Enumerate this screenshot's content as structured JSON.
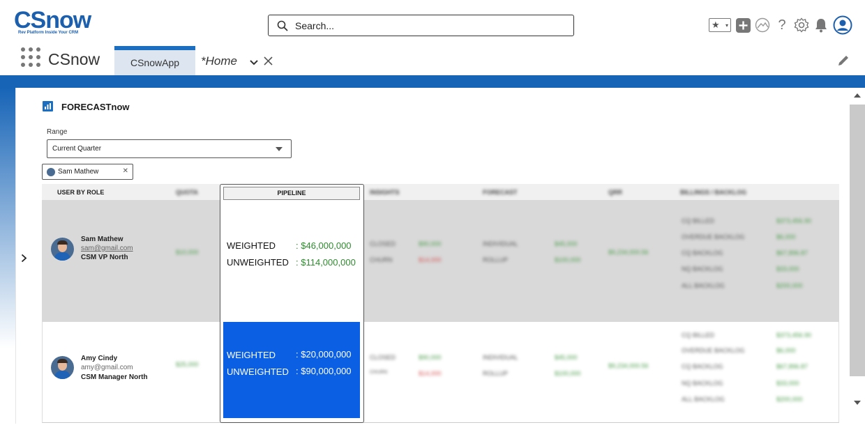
{
  "header": {
    "logo_text": "CSnow",
    "logo_tagline": "Rev Platform Inside Your CRM",
    "search_placeholder": "Search...",
    "help_icon": "?"
  },
  "nav": {
    "app_name": "CSnow",
    "tabs": [
      {
        "label": "CSnowApp",
        "active": true
      },
      {
        "label": "*Home",
        "active": false
      }
    ]
  },
  "forecast": {
    "title": "FORECASTnow",
    "range_label": "Range",
    "range_value": "Current Quarter",
    "user_filter": "Sam Mathew"
  },
  "table": {
    "columns": [
      "USER BY ROLE",
      "QUOTA",
      "PIPELINE",
      "INSIGHTS",
      "FORECAST",
      "QRR",
      "BILLINGS / BACKLOG"
    ],
    "rows": [
      {
        "name": "Sam Mathew",
        "email": "sam@gmail.com",
        "role": "CSM VP North",
        "quota": "$10,000",
        "pipeline": [
          {
            "label": "WEIGHTED",
            "value": "$46,000,000"
          },
          {
            "label": "UNWEIGHTED",
            "value": "$114,000,000"
          }
        ],
        "insights": [
          {
            "label": "CLOSED",
            "value": "$90,000"
          },
          {
            "label": "CHURN",
            "value": "$14,000"
          }
        ],
        "forecast": [
          {
            "label": "INDIVIDUAL",
            "value": "$45,000"
          },
          {
            "label": "ROLLUP",
            "value": "$100,000"
          }
        ],
        "qrr": "$9,234,000.56",
        "billings": [
          {
            "label": "CQ BILLED",
            "value": "$373,456.90"
          },
          {
            "label": "OVERDUE BACKLOG",
            "value": "$6,000"
          },
          {
            "label": "CQ BACKLOG",
            "value": "$67,896.87"
          },
          {
            "label": "NQ BACKLOG",
            "value": "$33,000"
          },
          {
            "label": "ALL BACKLOG",
            "value": "$200,000"
          }
        ]
      },
      {
        "name": "Amy Cindy",
        "email": "amy@gmail.com",
        "role": "CSM Manager North",
        "quota": "$25,000",
        "pipeline": [
          {
            "label": "WEIGHTED",
            "value": "$20,000,000"
          },
          {
            "label": "UNWEIGHTED",
            "value": "$90,000,000"
          }
        ],
        "insights": [
          {
            "label": "CLOSED",
            "value": "$90,000"
          },
          {
            "label": "CHURN",
            "value": "$14,000"
          }
        ],
        "forecast": [
          {
            "label": "INDIVIDUAL",
            "value": "$45,000"
          },
          {
            "label": "ROLLUP",
            "value": "$100,000"
          }
        ],
        "qrr": "$9,234,000.56",
        "billings": [
          {
            "label": "CQ BILLED",
            "value": "$373,456.90"
          },
          {
            "label": "OVERDUE BACKLOG",
            "value": "$6,000"
          },
          {
            "label": "CQ BACKLOG",
            "value": "$67,896.87"
          },
          {
            "label": "NQ BACKLOG",
            "value": "$33,000"
          },
          {
            "label": "ALL BACKLOG",
            "value": "$200,000"
          }
        ]
      }
    ]
  },
  "colors": {
    "brand_blue": "#1764b7",
    "selection_blue": "#0b5fe3",
    "value_green": "#2e8b2e"
  }
}
